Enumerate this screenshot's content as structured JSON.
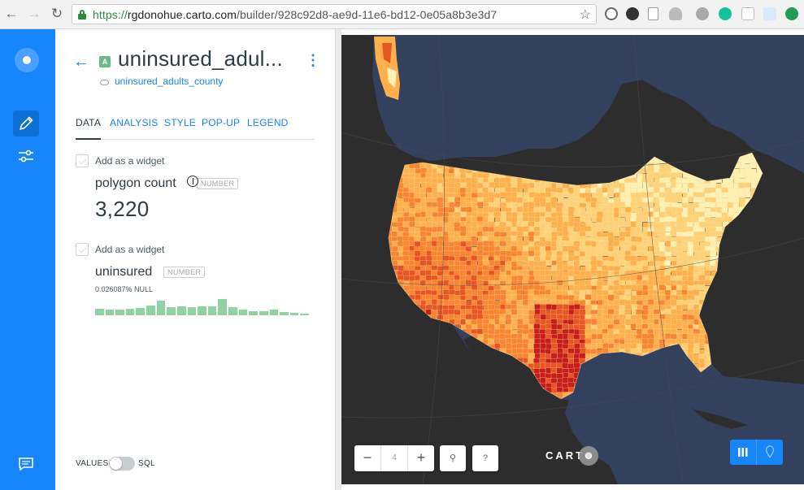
{
  "browser": {
    "url_proto": "https://",
    "url_host": "rgdonohue.carto.com",
    "url_path": "/builder/928c92d8-ae9d-11e6-bd12-0e05a8b3e3d7",
    "nav_icons": [
      "back-arrow-icon",
      "forward-arrow-icon",
      "reload-icon"
    ],
    "extension_icons": [
      "refresh-ext-icon",
      "info-ext-icon",
      "doc-ext-icon",
      "cloud-ext-icon",
      "leaf-ext-icon",
      "grammarly-icon",
      "shield-ext-icon",
      "page-ext-icon",
      "upload-ext-icon"
    ]
  },
  "layer": {
    "badge": "A",
    "title": "uninsured_adul...",
    "source": "uninsured_adults_county"
  },
  "tabs": [
    {
      "label": "DATA",
      "active": true
    },
    {
      "label": "ANALYSIS",
      "active": false
    },
    {
      "label": "STYLE",
      "active": false
    },
    {
      "label": "POP-UP",
      "active": false
    },
    {
      "label": "LEGEND",
      "active": false
    }
  ],
  "widgets": [
    {
      "checkbox_label": "Add as a widget",
      "title": "polygon count",
      "type": "NUMBER",
      "value": "3,220"
    },
    {
      "checkbox_label": "Add as a widget",
      "title": "uninsured",
      "type": "NUMBER",
      "null_text": "0.026087% NULL",
      "histogram": [
        0.35,
        0.3,
        0.3,
        0.35,
        0.4,
        0.55,
        0.8,
        0.45,
        0.5,
        0.45,
        0.5,
        0.5,
        0.9,
        0.45,
        0.3,
        0.25,
        0.25,
        0.3,
        0.2,
        0.15,
        0.1
      ]
    }
  ],
  "toggle": {
    "left": "VALUES",
    "right": "SQL",
    "state": "off"
  },
  "map": {
    "zoom_level": "4",
    "zoom_minus": "−",
    "zoom_plus": "+",
    "search_icon": "⚲",
    "help_label": "?",
    "attribution": "CARTO",
    "colors": {
      "ocean": "#33415f",
      "land_outside": "#2d2d2d",
      "ramp": [
        "#fff0b3",
        "#ffd27a",
        "#ffb04e",
        "#f98533",
        "#e85524",
        "#c81d1d"
      ]
    }
  },
  "colors": {
    "accent": "#1785fb",
    "rail": "#1785fb",
    "text": "#2e3c43",
    "histogram": "#8fd3a3"
  }
}
